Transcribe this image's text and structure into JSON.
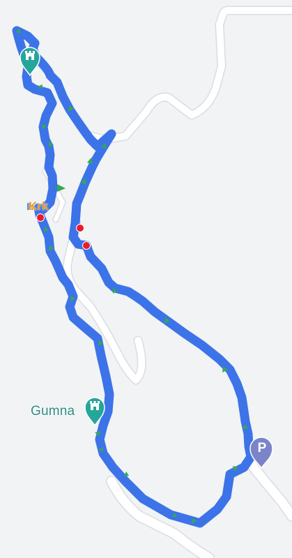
{
  "map": {
    "background_color": "#f1f3f4",
    "road_color": "#ffffff",
    "road_edge_color": "#dadce0",
    "route_color": "#3d73e8",
    "route_arrow_color": "#34a853",
    "stop_color": "#ea1c2a"
  },
  "places": {
    "gumna": {
      "label": "Gumna",
      "icon": "castle-icon",
      "color": "#26a69a"
    },
    "krk": {
      "label": "Krk",
      "color": "#e59a2c"
    },
    "castle_top": {
      "icon": "castle-icon",
      "color": "#26a69a"
    },
    "parking": {
      "label": "P",
      "icon": "parking-icon",
      "color": "#7b83c9"
    }
  }
}
